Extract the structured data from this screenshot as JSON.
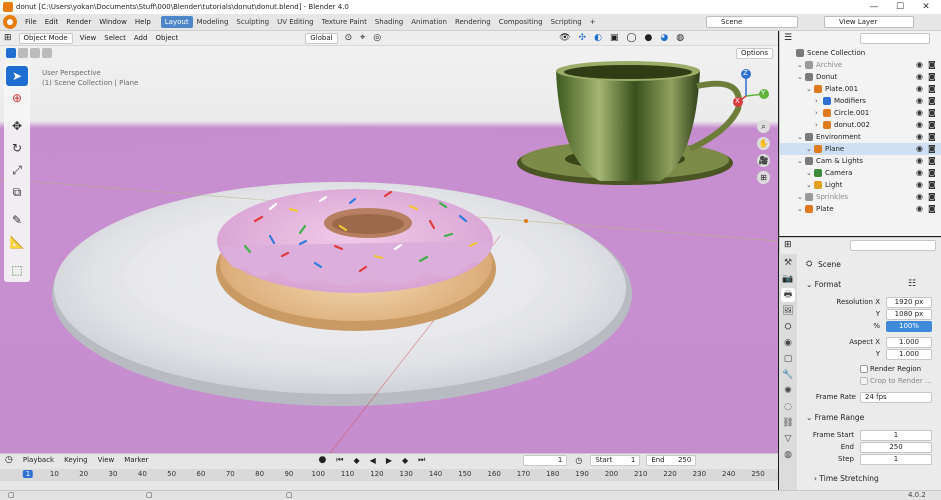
{
  "window": {
    "title": "donut [C:\\Users\\yokan\\Documents\\Stuff\\000\\Blender\\tutorials\\donut\\donut.blend] - Blender 4.0",
    "minimize": "—",
    "maximize": "☐",
    "close": "✕"
  },
  "menu": {
    "items": [
      "File",
      "Edit",
      "Render",
      "Window",
      "Help"
    ]
  },
  "workspaces": [
    "Layout",
    "Modeling",
    "Sculpting",
    "UV Editing",
    "Texture Paint",
    "Shading",
    "Animation",
    "Rendering",
    "Compositing",
    "Scripting",
    "+"
  ],
  "header_right": {
    "scene": "Scene",
    "view_layer": "View Layer"
  },
  "viewport": {
    "mode": "Object Mode",
    "menus": [
      "View",
      "Select",
      "Add",
      "Object"
    ],
    "transform": "Global",
    "options": "Options",
    "overlay_title": "User Perspective",
    "overlay_collection": "(1) Scene Collection | Plane",
    "gizmo": {
      "z": "Z",
      "y": "Y",
      "x": "X"
    }
  },
  "outliner": {
    "search_placeholder": "",
    "rows": [
      {
        "label": "Scene Collection",
        "indent": 0,
        "icon": "collection-icon",
        "color": "#7a7a7a",
        "dim": false
      },
      {
        "label": "Archive",
        "indent": 1,
        "icon": "collection-icon",
        "color": "#9a9a9a",
        "dim": true
      },
      {
        "label": "Donut",
        "indent": 1,
        "icon": "collection-icon",
        "color": "#7a7a7a",
        "dim": false
      },
      {
        "label": "Plate.001",
        "indent": 2,
        "icon": "mesh-icon",
        "color": "#e07a1f",
        "dim": false
      },
      {
        "label": "Modifiers",
        "indent": 3,
        "icon": "wrench-icon",
        "color": "#2f6fd1",
        "dim": false
      },
      {
        "label": "Circle.001",
        "indent": 3,
        "icon": "mesh-icon",
        "color": "#e07a1f",
        "dim": false
      },
      {
        "label": "donut.002",
        "indent": 3,
        "icon": "mesh-icon",
        "color": "#e07a1f",
        "dim": false
      },
      {
        "label": "Environment",
        "indent": 1,
        "icon": "collection-icon",
        "color": "#7a7a7a",
        "dim": false
      },
      {
        "label": "Plane",
        "indent": 2,
        "icon": "mesh-icon",
        "color": "#e07a1f",
        "dim": false,
        "selected": true
      },
      {
        "label": "Cam & Lights",
        "indent": 1,
        "icon": "collection-icon",
        "color": "#7a7a7a",
        "dim": false
      },
      {
        "label": "Camera",
        "indent": 2,
        "icon": "camera-icon",
        "color": "#3d8a3d",
        "dim": false
      },
      {
        "label": "Light",
        "indent": 2,
        "icon": "light-icon",
        "color": "#e0a020",
        "dim": false
      },
      {
        "label": "Sprinkles",
        "indent": 1,
        "icon": "collection-icon",
        "color": "#9a9a9a",
        "dim": true
      },
      {
        "label": "Plate",
        "indent": 1,
        "icon": "mesh-icon",
        "color": "#e07a1f",
        "dim": false
      }
    ]
  },
  "properties": {
    "context": "Scene",
    "format_title": "Format",
    "resolution_x_label": "Resolution X",
    "resolution_x": "1920 px",
    "y_label": "Y",
    "resolution_y": "1080 px",
    "pct_label": "%",
    "resolution_pct": "100%",
    "aspect_x_label": "Aspect X",
    "aspect_x": "1.000",
    "aspect_y_label": "Y",
    "aspect_y": "1.000",
    "render_region": "Render Region",
    "crop_to_render": "Crop to Render ...",
    "frame_rate_label": "Frame Rate",
    "frame_rate": "24 fps",
    "frame_range_title": "Frame Range",
    "frame_start_label": "Frame Start",
    "frame_start": "1",
    "end_label": "End",
    "end": "250",
    "step_label": "Step",
    "step": "1",
    "time_stretching": "Time Stretching"
  },
  "timeline": {
    "menus": [
      "Playback",
      "Keying",
      "View",
      "Marker"
    ],
    "current_frame": "1",
    "start_label": "Start",
    "start": "1",
    "end_label": "End",
    "end": "250",
    "ticks": [
      "1",
      "10",
      "20",
      "30",
      "40",
      "50",
      "60",
      "70",
      "80",
      "90",
      "100",
      "110",
      "120",
      "130",
      "140",
      "150",
      "160",
      "170",
      "180",
      "190",
      "200",
      "210",
      "220",
      "230",
      "240",
      "250"
    ]
  },
  "status": {
    "version": "4.0.2"
  }
}
